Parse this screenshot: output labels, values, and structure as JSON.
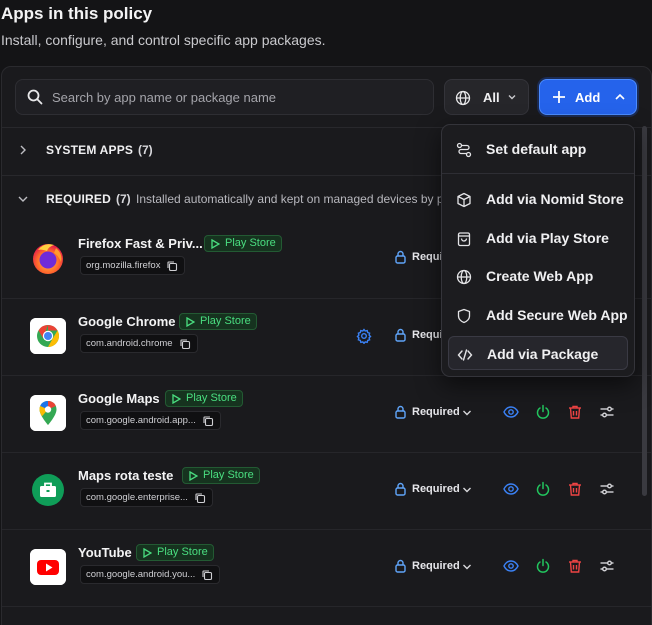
{
  "header": {
    "title": "Apps in this policy",
    "subtitle": "Install, configure, and control specific app packages."
  },
  "toolbar": {
    "search_placeholder": "Search by app name or package name",
    "filter_label": "All",
    "add_label": "Add"
  },
  "sections": {
    "system": {
      "name": "SYSTEM APPS",
      "count": "(7)"
    },
    "required": {
      "name": "REQUIRED",
      "count": "(7)",
      "description": "Installed automatically and kept on managed devices by po"
    }
  },
  "apps": [
    {
      "name": "Firefox Fast & Priv...",
      "store": "Play Store",
      "package": "org.mozilla.firefox",
      "status": "Required",
      "icon": "firefox-icon"
    },
    {
      "name": "Google Chrome",
      "store": "Play Store",
      "package": "com.android.chrome",
      "status": "Required",
      "icon": "chrome-icon"
    },
    {
      "name": "Google Maps",
      "store": "Play Store",
      "package": "com.google.android.app...",
      "status": "Required",
      "icon": "google-maps-icon"
    },
    {
      "name": "Maps rota teste",
      "store": "Play Store",
      "package": "com.google.enterprise...",
      "status": "Required",
      "icon": "briefcase-icon"
    },
    {
      "name": "YouTube",
      "store": "Play Store",
      "package": "com.google.android.you...",
      "status": "Required",
      "icon": "youtube-icon"
    }
  ],
  "add_menu": [
    {
      "label": "Set default app",
      "icon": "route-icon"
    },
    {
      "label": "Add via Nomid Store",
      "icon": "package-box-icon"
    },
    {
      "label": "Add via Play Store",
      "icon": "shopping-bag-icon"
    },
    {
      "label": "Create Web App",
      "icon": "globe-icon"
    },
    {
      "label": "Add Secure Web App",
      "icon": "shield-icon"
    },
    {
      "label": "Add via Package",
      "icon": "code-icon"
    }
  ],
  "colors": {
    "accent": "#2563eb",
    "store_green": "#4ade80",
    "view_blue": "#3b82f6",
    "power_green": "#22c55e",
    "delete_red": "#ef4444"
  }
}
